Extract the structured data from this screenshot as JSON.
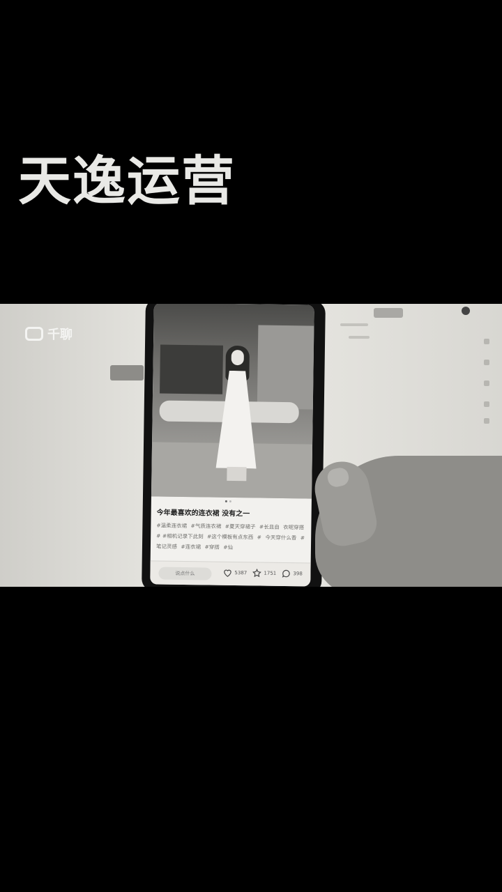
{
  "overlay": {
    "title": "天逸运营"
  },
  "video": {
    "watermark": {
      "icon": "tv-icon",
      "text": "千聊"
    },
    "post": {
      "title": "今年最喜欢的连衣裙 没有之一",
      "tags": [
        "#温柔连衣裙",
        "#气质连衣裙",
        "#夏天穿裙子",
        "#长且自",
        "衣呢穿搭",
        "# #相机记录下此刻",
        "#这个模板有点东西",
        "#",
        "今天穿什么香",
        "#笔记灵感",
        "#连衣裙",
        "#穿搭",
        "#仙"
      ],
      "comment_placeholder": "说点什么",
      "likes": "5387",
      "stars": "1751",
      "comments": "398"
    }
  }
}
